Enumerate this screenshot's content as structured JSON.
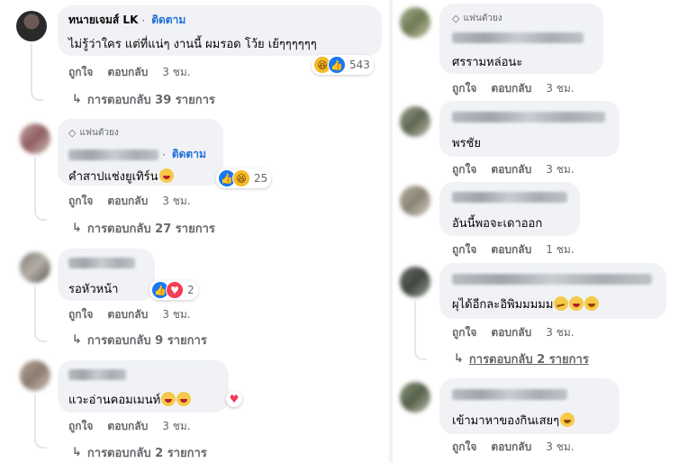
{
  "left_comments": [
    {
      "author": "ทนายเจมส์ LK",
      "follow_label": "ติดตาม",
      "text": "ไม่รู้ว่าใคร แต่ที่แน่ๆ งานนี้ ผมรอด โว้ย เย้ๆๆๆๆๆๆ",
      "reaction_count": "543",
      "like_label": "ถูกใจ",
      "reply_label": "ตอบกลับ",
      "time": "3 ชม.",
      "replies_label": "การตอบกลับ 39 รายการ"
    },
    {
      "badge": "แฟนตัวยง",
      "follow_label": "ติดตาม",
      "text": "คำสาปแช่งยูเทิร์น",
      "reaction_count": "25",
      "like_label": "ถูกใจ",
      "reply_label": "ตอบกลับ",
      "time": "3 ชม.",
      "replies_label": "การตอบกลับ 27 รายการ"
    },
    {
      "text": "รอหัวหน้า",
      "reaction_count": "2",
      "like_label": "ถูกใจ",
      "reply_label": "ตอบกลับ",
      "time": "3 ชม.",
      "replies_label": "การตอบกลับ 9 รายการ"
    },
    {
      "text": "แวะอ่านคอมเมนท์",
      "like_label": "ถูกใจ",
      "reply_label": "ตอบกลับ",
      "time": "3 ชม.",
      "replies_label": "การตอบกลับ 2 รายการ"
    }
  ],
  "right_comments": [
    {
      "badge": "แฟนตัวยง",
      "text": "ศรรามหล่อนะ",
      "like_label": "ถูกใจ",
      "reply_label": "ตอบกลับ",
      "time": "3 ชม."
    },
    {
      "text": "พรชัย",
      "like_label": "ถูกใจ",
      "reply_label": "ตอบกลับ",
      "time": "3 ชม."
    },
    {
      "text": "อันนี้พอจะเดาออก",
      "like_label": "ถูกใจ",
      "reply_label": "ตอบกลับ",
      "time": "1 ชม."
    },
    {
      "text": "ผุได้อีกละอิพิมมมมม",
      "like_label": "ถูกใจ",
      "reply_label": "ตอบกลับ",
      "time": "3 ชม.",
      "replies_label": "การตอบกลับ 2 รายการ"
    },
    {
      "text": "เข้ามาหาของกินเสยๆ",
      "like_label": "ถูกใจ",
      "reply_label": "ตอบกลับ",
      "time": "3 ชม."
    }
  ],
  "icons": {
    "like": "like-reaction-icon",
    "haha": "haha-reaction-icon",
    "love": "love-reaction-icon",
    "gem": "diamond-badge-icon",
    "reply_arrow": "reply-arrow-icon"
  },
  "colors": {
    "accent": "#216fdb",
    "bubble": "#f0f2f5",
    "muted": "#65676b"
  }
}
